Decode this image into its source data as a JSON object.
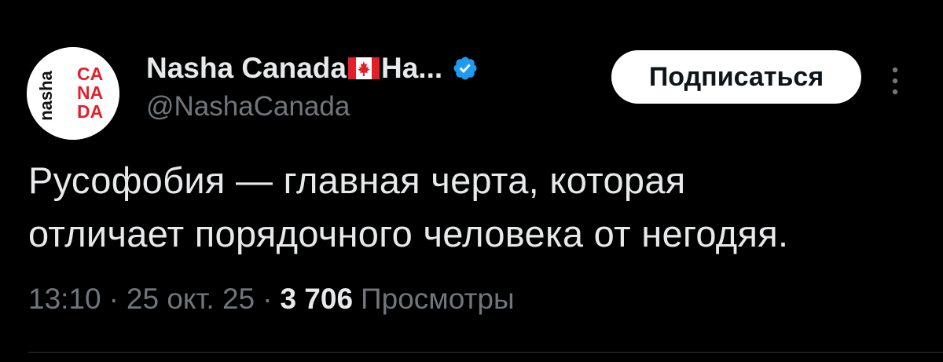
{
  "author": {
    "display_name": "Nasha Canada",
    "name_suffix": "На...",
    "handle": "@NashaCanada",
    "verified": true,
    "avatar_logo": {
      "left_text": "nasha",
      "right_lines": [
        "CA",
        "NA",
        "DA"
      ]
    }
  },
  "follow_button": {
    "label": "Подписаться"
  },
  "more_menu": {
    "icon": "more-vertical-icon"
  },
  "tweet": {
    "text": "Русофобия — главная черта, которая\nотличает порядочного человека от негодяя."
  },
  "meta": {
    "time": "13:10",
    "date": "25 окт. 25",
    "views_count": "3 706",
    "views_label": "Просмотры",
    "separator": "·"
  },
  "colors": {
    "background": "#000000",
    "text_primary": "#e7e9ea",
    "text_secondary": "#71767b",
    "verified_blue": "#1d9bf0",
    "brand_red": "#e3202a",
    "button_bg": "#ffffff",
    "button_text": "#0f1419"
  }
}
